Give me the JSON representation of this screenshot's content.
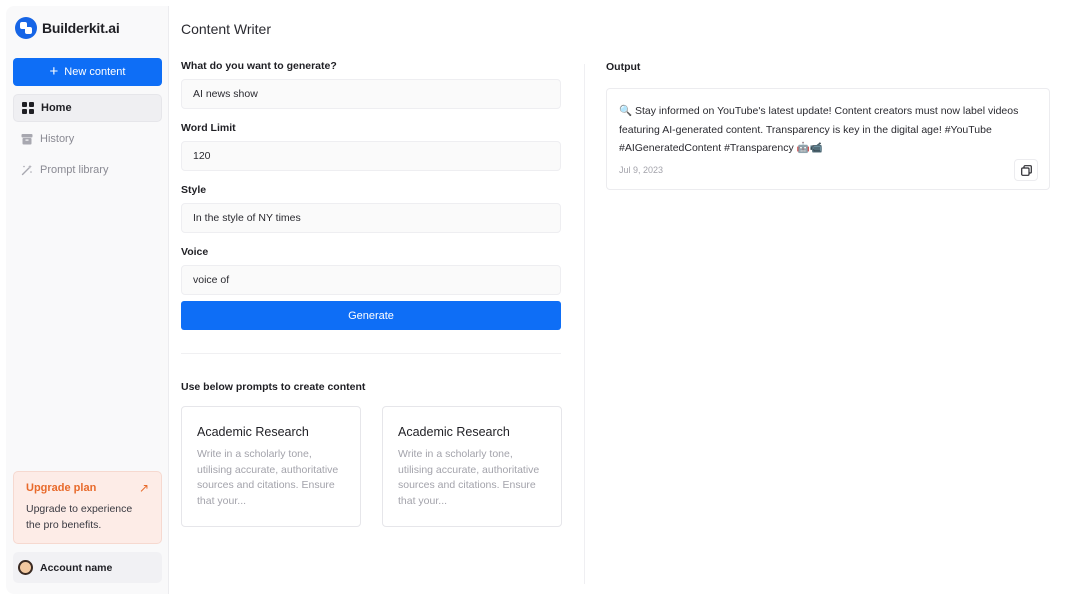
{
  "brand": {
    "name": "Builderkit.ai"
  },
  "sidebar": {
    "new_content_label": "New content",
    "items": [
      {
        "label": "Home",
        "icon": "grid-icon"
      },
      {
        "label": "History",
        "icon": "archive-icon"
      },
      {
        "label": "Prompt library",
        "icon": "magic-wand-icon"
      }
    ],
    "upgrade": {
      "title": "Upgrade plan",
      "arrow": "↗",
      "description": "Upgrade to experience the pro benefits."
    },
    "account": {
      "name": "Account name"
    }
  },
  "main": {
    "title": "Content Writer",
    "fields": [
      {
        "label": "What do you want to generate?",
        "value": "AI news show"
      },
      {
        "label": "Word Limit",
        "value": "120"
      },
      {
        "label": "Style",
        "value": "In the style of NY times"
      },
      {
        "label": "Voice",
        "value": "voice of"
      }
    ],
    "generate_label": "Generate",
    "prompts_heading": "Use below prompts to create content",
    "prompts": [
      {
        "title": "Academic Research",
        "description": "Write in a scholarly tone, utilising accurate, authoritative sources and citations. Ensure that your..."
      },
      {
        "title": "Academic Research",
        "description": "Write in a scholarly tone, utilising accurate, authoritative sources and citations. Ensure that your..."
      }
    ]
  },
  "output": {
    "label": "Output",
    "text": "🔍 Stay informed on YouTube's latest update! Content creators must now label videos featuring AI-generated content. Transparency is key in the digital age! #YouTube #AIGeneratedContent #Transparency 🤖📹",
    "date": "Jul 9, 2023"
  },
  "colors": {
    "accent": "#0e6ef6",
    "upgrade_text": "#e86a2b",
    "upgrade_bg": "#fdece7"
  }
}
